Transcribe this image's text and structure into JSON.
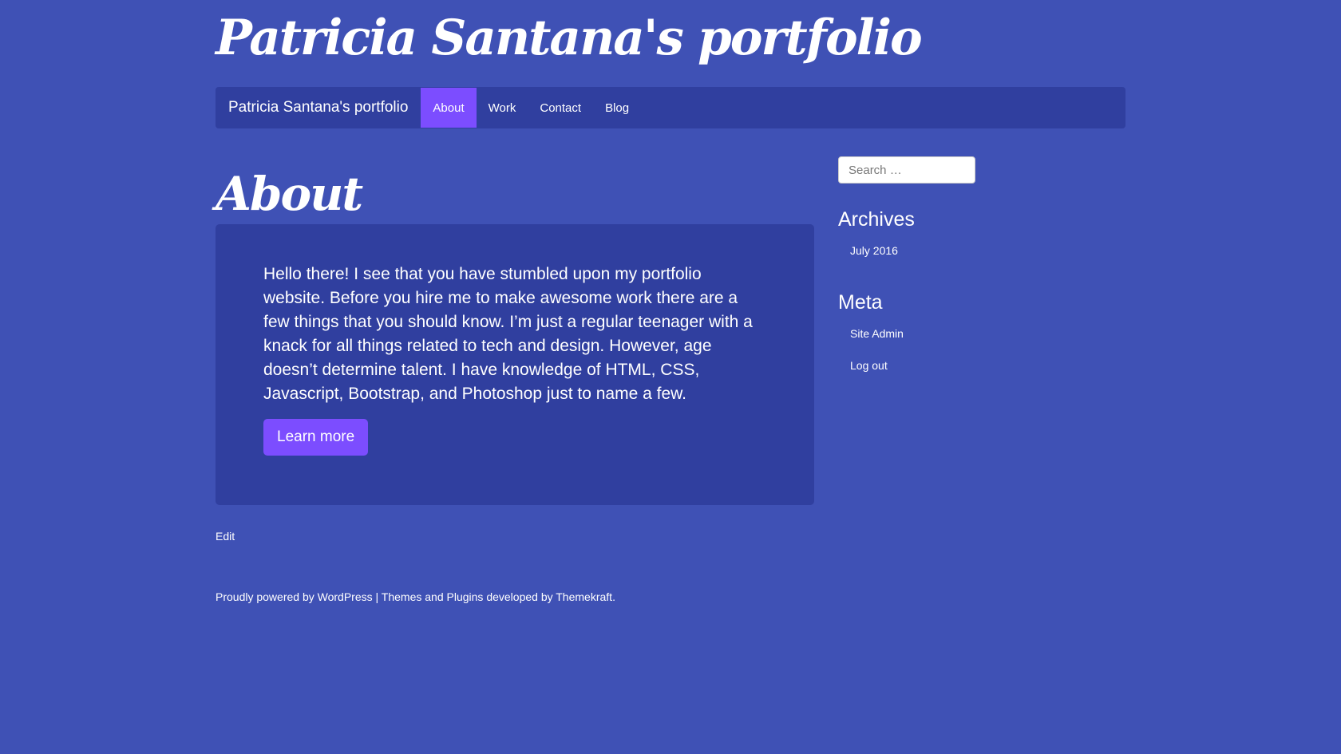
{
  "site": {
    "title": "Patricia Santana's portfolio"
  },
  "navbar": {
    "brand": "Patricia Santana's portfolio",
    "items": [
      {
        "label": "About",
        "active": true
      },
      {
        "label": "Work",
        "active": false
      },
      {
        "label": "Contact",
        "active": false
      },
      {
        "label": "Blog",
        "active": false
      }
    ]
  },
  "main": {
    "page_title": "About",
    "intro": "Hello there! I see that you have stumbled upon my portfolio website. Before you hire me to make awesome work there are a few things that you should know. I’m just a regular teenager with a knack for all things related to tech and design. However, age doesn’t determine talent. I have knowledge of HTML, CSS, Javascript, Bootstrap, and Photoshop just to name a few.",
    "cta_label": "Learn more",
    "edit_label": "Edit"
  },
  "sidebar": {
    "search_placeholder": "Search …",
    "archives": {
      "title": "Archives",
      "items": [
        "July 2016"
      ]
    },
    "meta": {
      "title": "Meta",
      "items": [
        "Site Admin",
        "Log out"
      ]
    }
  },
  "footer": {
    "powered_prefix": "Proudly powered by ",
    "wordpress": "WordPress",
    "separator": " | ",
    "themes_prefix": "Themes and Plugins developed by ",
    "themekraft": "Themekraft",
    "suffix": "."
  },
  "colors": {
    "background": "#3f51b5",
    "panel": "#303f9f",
    "accent": "#7c4dff",
    "text": "#ffffff"
  }
}
